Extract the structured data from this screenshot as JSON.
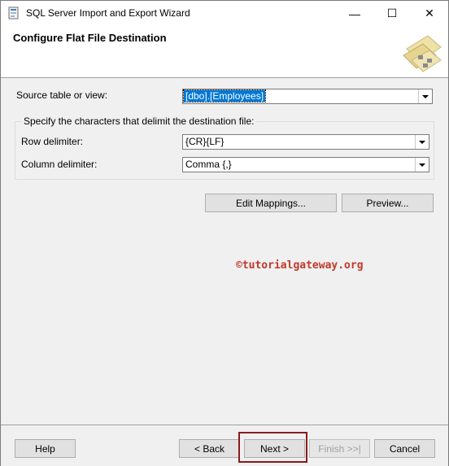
{
  "window": {
    "title": "SQL Server Import and Export Wizard",
    "controls": {
      "minimize": "—",
      "maximize": "☐",
      "close": "✕"
    }
  },
  "header": {
    "title": "Configure Flat File Destination"
  },
  "form": {
    "source_label": "Source table or view:",
    "source_value": "[dbo].[Employees]",
    "group_label": "Specify the characters that delimit the destination file:",
    "row_delim_label": "Row delimiter:",
    "row_delim_value": "{CR}{LF}",
    "col_delim_label": "Column delimiter:",
    "col_delim_value": "Comma {,}",
    "edit_mappings": "Edit Mappings...",
    "preview": "Preview..."
  },
  "watermark": "©tutorialgateway.org",
  "footer": {
    "help": "Help",
    "back": "< Back",
    "next": "Next >",
    "finish": "Finish >>|",
    "cancel": "Cancel"
  },
  "colors": {
    "selection": "#0078d7",
    "highlight_border": "#8b1a1a",
    "watermark": "#c0392b"
  }
}
